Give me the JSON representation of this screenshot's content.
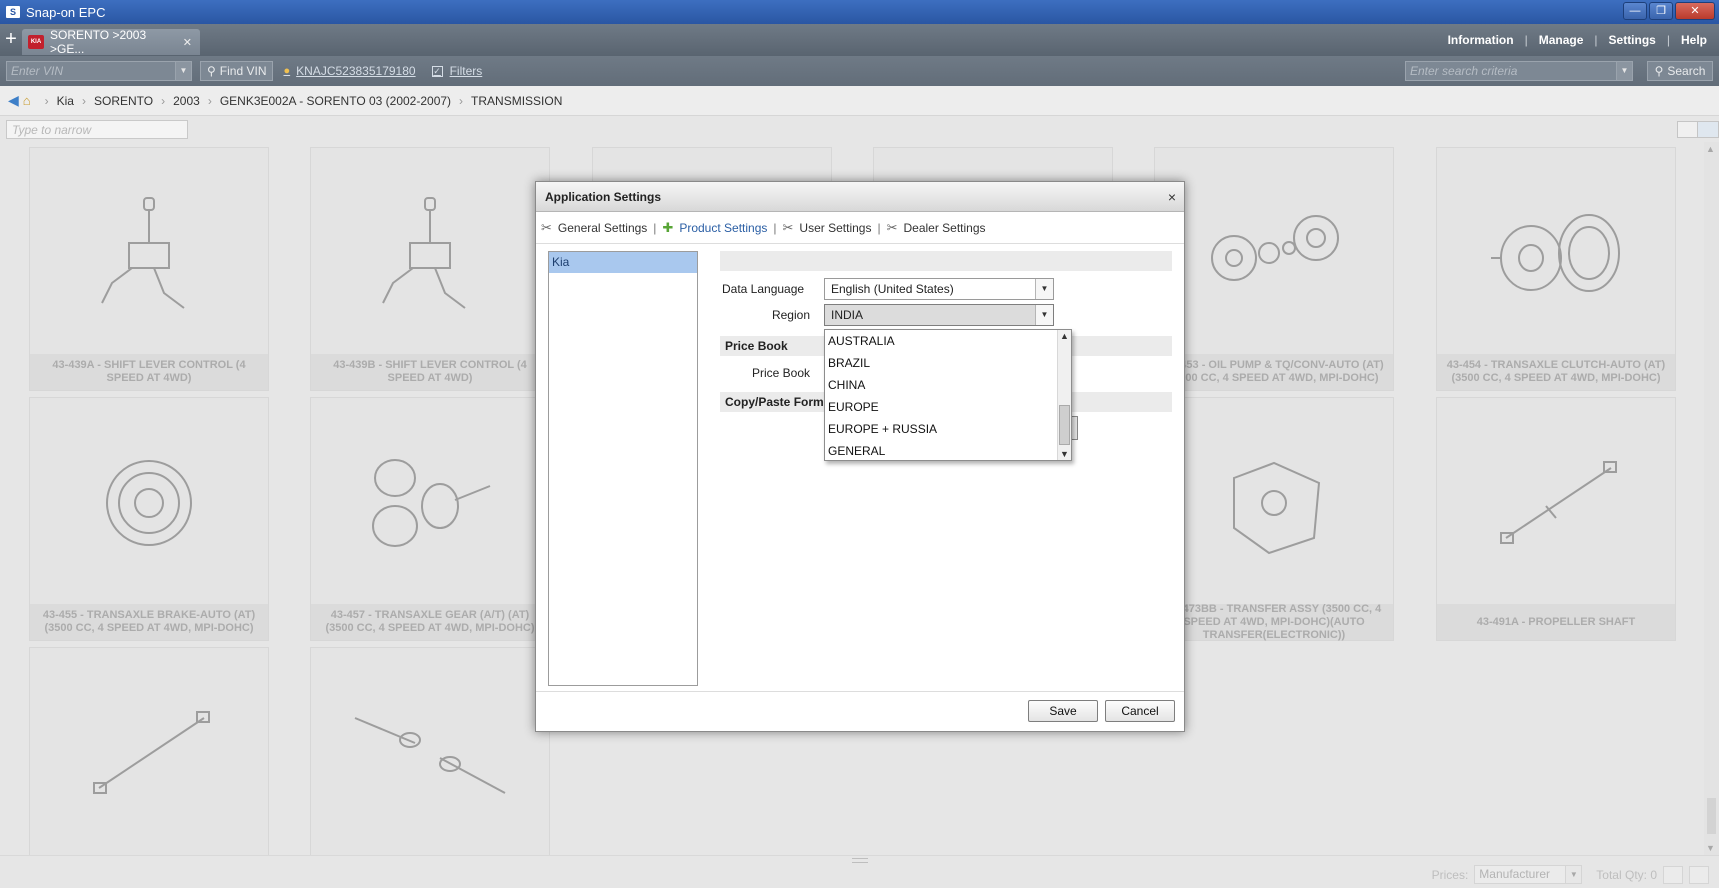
{
  "window": {
    "title": "Snap-on EPC",
    "buttons": [
      "—",
      "❐",
      "✕"
    ]
  },
  "tabbar": {
    "tab_label": "SORENTO >2003 >GE...",
    "menu": [
      "Information",
      "Manage",
      "Settings",
      "Help"
    ]
  },
  "toolbar": {
    "vin_placeholder": "Enter VIN",
    "find_vin_label": "Find VIN",
    "vin_link": "KNAJC523835179180",
    "filters_label": "Filters",
    "search_placeholder": "Enter search criteria",
    "search_label": "Search"
  },
  "breadcrumb": [
    "Kia",
    "SORENTO",
    "2003",
    "GENK3E002A - SORENTO 03 (2002-2007)",
    "TRANSMISSION"
  ],
  "narrow_placeholder": "Type to narrow",
  "cards": [
    "43-439A - SHIFT LEVER CONTROL (4 SPEED AT 4WD)",
    "43-439B - SHIFT LEVER CONTROL (4 SPEED AT 4WD)",
    "43-453 - OIL PUMP & TQ/CONV-AUTO (AT) (3500 CC, 4 SPEED AT 4WD, MPI-DOHC)",
    "43-454 - TRANSAXLE CLUTCH-AUTO (AT) (3500 CC, 4 SPEED AT 4WD, MPI-DOHC)",
    "43-455 - TRANSAXLE BRAKE-AUTO (AT) (3500 CC, 4 SPEED AT 4WD, MPI-DOHC)",
    "43-457 - TRANSAXLE GEAR (A/T) (AT) (3500 CC, 4 SPEED AT 4WD, MPI-DOHC)",
    "43-473BB - TRANSFER ASSY (3500 CC, 4 SPEED AT 4WD, MPI-DOHC)(AUTO TRANSFER(ELECTRONIC))",
    "43-491A - PROPELLER SHAFT"
  ],
  "status": {
    "prices_label": "Prices:",
    "prices_value": "Manufacturer",
    "total_qty": "Total Qty: 0"
  },
  "dialog": {
    "title": "Application Settings",
    "close": "×",
    "tabs": [
      "General Settings",
      "Product Settings",
      "User Settings",
      "Dealer Settings"
    ],
    "list_items": [
      "Kia"
    ],
    "data_language_label": "Data Language",
    "data_language_value": "English (United States)",
    "region_label": "Region",
    "region_value": "INDIA",
    "price_book_section": "Price Book",
    "price_book_label": "Price Book",
    "copy_paste_section": "Copy/Paste Forma",
    "region_options": [
      "AUSTRALIA",
      "BRAZIL",
      "CHINA",
      "EUROPE",
      "EUROPE + RUSSIA",
      "GENERAL"
    ],
    "save_label": "Save",
    "cancel_label": "Cancel"
  }
}
